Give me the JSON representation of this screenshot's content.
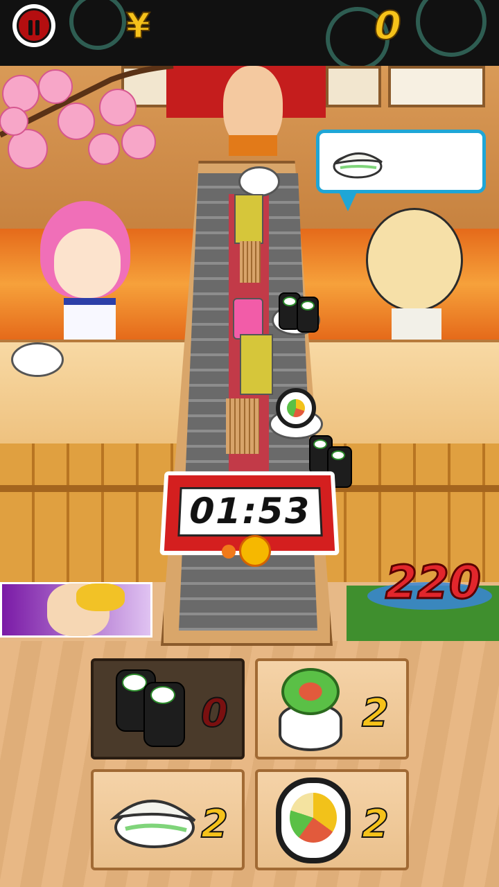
{
  "hud": {
    "currency_symbol": "¥",
    "money": "0",
    "score": "220",
    "timer": "01:53"
  },
  "icons": {
    "pause": "pause-icon",
    "order_item": "ika-nigiri-icon"
  },
  "ammo": [
    {
      "name": "kappa-maki",
      "count": "0",
      "enabled": false
    },
    {
      "name": "salad-roll",
      "count": "2",
      "enabled": true
    },
    {
      "name": "ika-nigiri",
      "count": "2",
      "enabled": true
    },
    {
      "name": "futomaki",
      "count": "2",
      "enabled": true
    }
  ],
  "colors": {
    "timer_frame": "#d41f1f",
    "score": "#e2262c",
    "counts": "#f6c21a",
    "bubble_border": "#1fa6d6"
  }
}
